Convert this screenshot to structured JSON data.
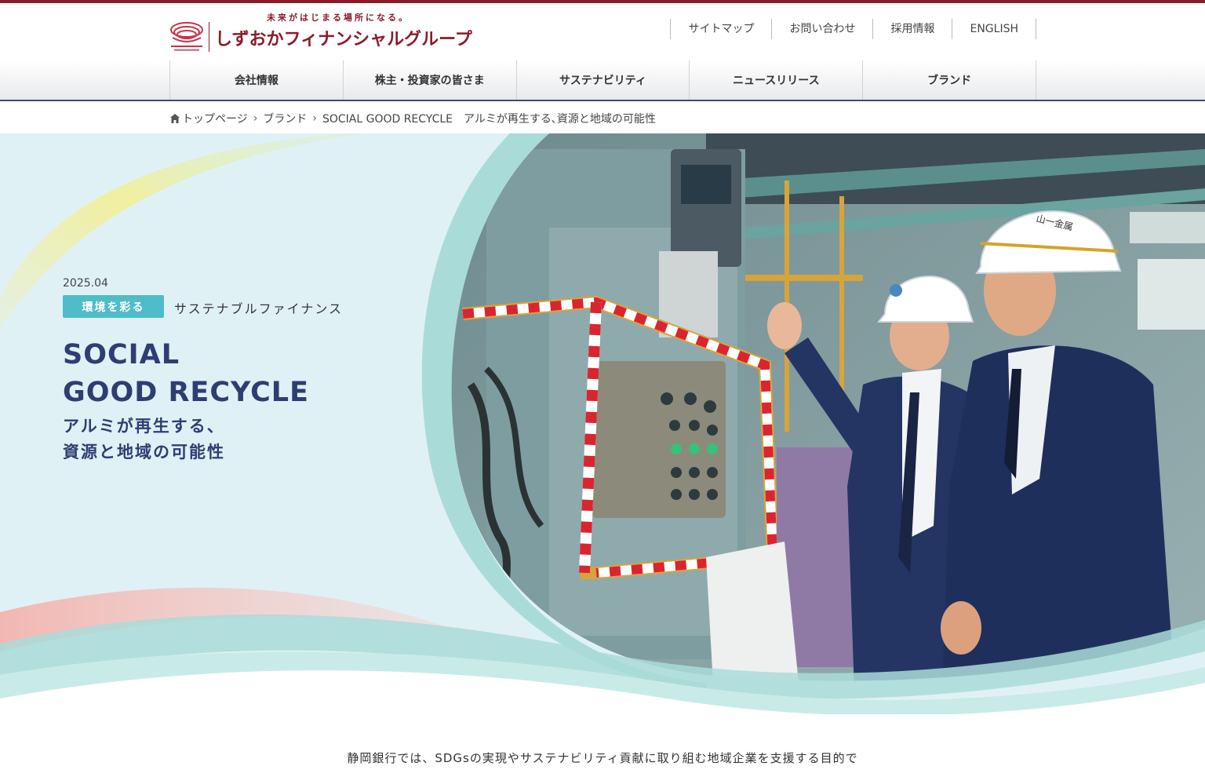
{
  "header": {
    "tagline": "未来がはじまる場所になる。",
    "logo_name": "しずおかフィナンシャルグループ",
    "util_nav": [
      "サイトマップ",
      "お問い合わせ",
      "採用情報",
      "ENGLISH"
    ]
  },
  "gnav": [
    "会社情報",
    "株主・投資家の皆さま",
    "サステナビリティ",
    "ニュースリリース",
    "ブランド"
  ],
  "breadcrumb": {
    "items": [
      "トップページ",
      "ブランド",
      "SOCIAL GOOD RECYCLE　アルミが再生する､資源と地域の可能性"
    ]
  },
  "hero": {
    "date": "2025.04",
    "tag": "環境を彩る",
    "category": "サステナブルファイナンス",
    "title_line1": "SOCIAL",
    "title_line2": "GOOD RECYCLE",
    "subtitle_line1": "アルミが再生する、",
    "subtitle_line2": "資源と地域の可能性",
    "helmet_text": "山一金属"
  },
  "intro": {
    "line1": "静岡銀行では、SDGsの実現やサステナビリティ貢献に取り組む地域企業を支援する目的で"
  },
  "colors": {
    "brand": "#8a1c2b",
    "navy": "#2e3d73",
    "teal": "#4fbcc9",
    "hero_bg": "#e0f1f6"
  }
}
